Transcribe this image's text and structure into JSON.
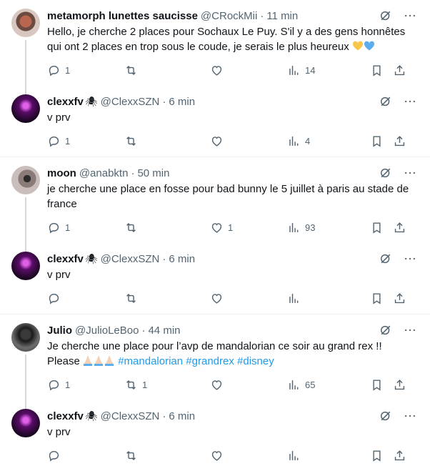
{
  "threads": [
    {
      "tweet": {
        "name": "metamorph lunettes saucisse",
        "handle": "@CRockMii",
        "time": "11 min",
        "text": "Hello, je cherche 2 places pour Sochaux Le Puy. S'il y a des gens honnêtes qui ont 2 places en trop sous le coude, je serais le plus heureux",
        "replies": "1",
        "retweets": "",
        "likes": "",
        "views": "14"
      },
      "reply": {
        "name": "clexxfv",
        "handle": "@ClexxSZN",
        "time": "6 min",
        "text": "v prv",
        "replies": "1",
        "retweets": "",
        "likes": "",
        "views": "4"
      }
    },
    {
      "tweet": {
        "name": "moon",
        "handle": "@anabktn",
        "time": "50 min",
        "text": "je cherche une place en fosse pour bad bunny le 5 juillet à paris au stade de france",
        "replies": "1",
        "retweets": "",
        "likes": "1",
        "views": "93"
      },
      "reply": {
        "name": "clexxfv",
        "handle": "@ClexxSZN",
        "time": "6 min",
        "text": "v prv",
        "replies": "",
        "retweets": "",
        "likes": "",
        "views": ""
      }
    },
    {
      "tweet": {
        "name": "Julio",
        "handle": "@JulioLeBoo",
        "time": "44 min",
        "text_line1": "Je cherche une place pour l’avp de mandalorian ce soir au grand rex !!",
        "text_line2_prefix": "Please",
        "hashtags": [
          "#mandalorian",
          "#grandrex",
          "#disney"
        ],
        "replies": "1",
        "retweets": "1",
        "likes": "",
        "views": "65"
      },
      "reply": {
        "name": "clexxfv",
        "handle": "@ClexxSZN",
        "time": "6 min",
        "text": "v prv",
        "replies": "",
        "retweets": "",
        "likes": "",
        "views": ""
      }
    }
  ],
  "separator": "·",
  "colors": {
    "hashtag": "#1d9bf0",
    "secondary": "#536471",
    "primary": "#0f1419"
  },
  "icons": [
    "grok-icon",
    "more-icon",
    "reply-icon",
    "retweet-icon",
    "like-icon",
    "views-icon",
    "bookmark-icon",
    "share-icon",
    "yellow-heart-icon",
    "blue-heart-icon",
    "praying-hands-icon",
    "spider-icon"
  ]
}
